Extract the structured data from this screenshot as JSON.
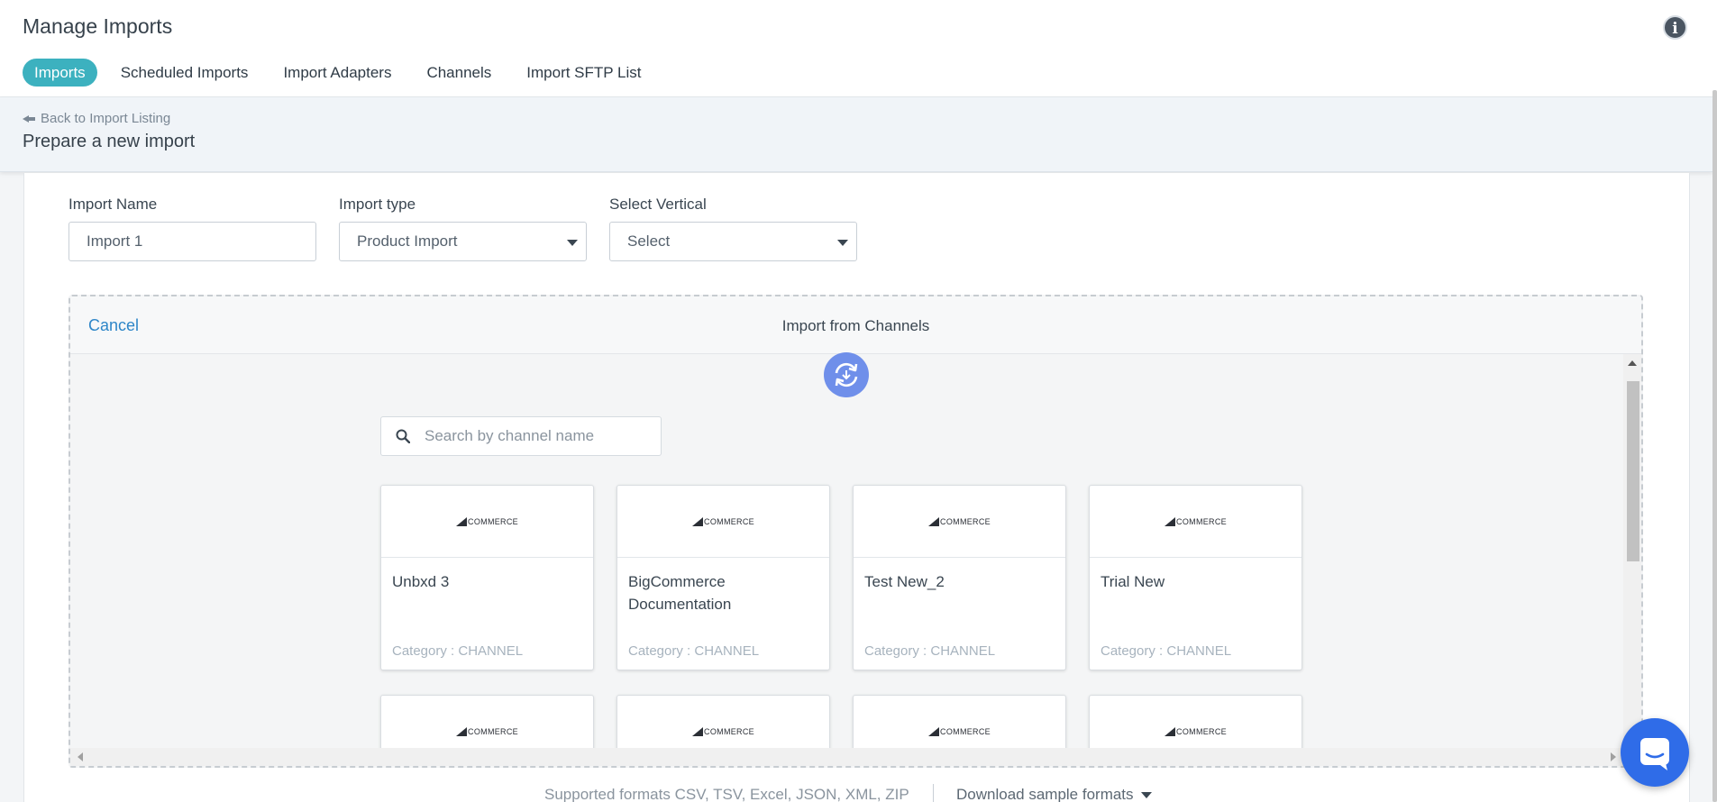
{
  "header": {
    "title": "Manage Imports",
    "info_icon": "info-icon",
    "tabs": [
      {
        "label": "Imports",
        "active": true
      },
      {
        "label": "Scheduled Imports",
        "active": false
      },
      {
        "label": "Import Adapters",
        "active": false
      },
      {
        "label": "Channels",
        "active": false
      },
      {
        "label": "Import SFTP List",
        "active": false
      }
    ]
  },
  "subheader": {
    "back_label": "Back to Import Listing",
    "title": "Prepare a new import"
  },
  "form": {
    "import_name": {
      "label": "Import Name",
      "value": "Import 1"
    },
    "import_type": {
      "label": "Import type",
      "value": "Product Import"
    },
    "vertical": {
      "label": "Select Vertical",
      "value": "Select"
    }
  },
  "channels_panel": {
    "cancel_label": "Cancel",
    "title": "Import from Channels",
    "search": {
      "placeholder": "Search by channel name",
      "value": ""
    },
    "logo_text": "COMMERCE",
    "tiles": [
      {
        "name": "Unbxd 3",
        "category": "Category : CHANNEL"
      },
      {
        "name": "BigCommerce Documentation",
        "category": "Category : CHANNEL"
      },
      {
        "name": "Test New_2",
        "category": "Category : CHANNEL"
      },
      {
        "name": "Trial New",
        "category": "Category : CHANNEL"
      }
    ]
  },
  "footer": {
    "formats": "Supported formats CSV, TSV, Excel, JSON, XML, ZIP",
    "download_label": "Download sample formats"
  },
  "colors": {
    "accent": "#3cb1bf",
    "link": "#2e86c8",
    "sync_button": "#6f8fea",
    "chat_button": "#2f6ce8"
  }
}
